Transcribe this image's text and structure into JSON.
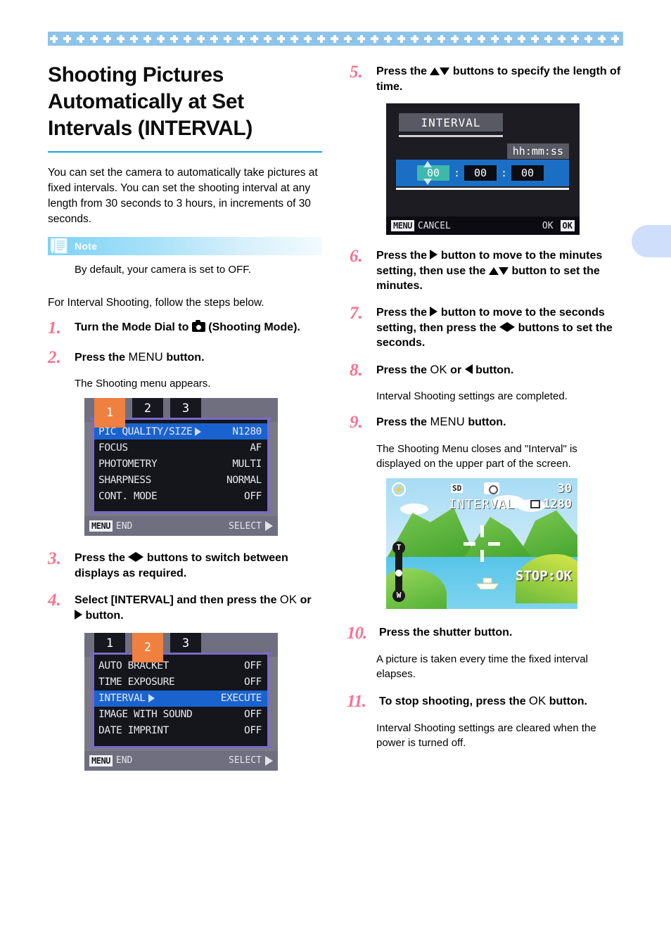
{
  "page": {
    "title": "Shooting Pictures Automatically at Set Intervals (INTERVAL)",
    "intro": "You can set the camera to automatically take pictures at fixed intervals. You can set the shooting interval at any length from 30 seconds to 3 hours, in increments of 30 seconds.",
    "lead": "For Interval Shooting, follow the steps below.",
    "accent_color": "#19a3dd",
    "step_number_color": "#f8728f",
    "band_color": "#8fc4ea"
  },
  "note": {
    "label": "Note",
    "icon": "note-pen-document-icon",
    "text": "By default, your camera is set to OFF."
  },
  "steps": [
    {
      "num": "1.",
      "text_before": "Turn the Mode Dial to ",
      "icon": "camera-mode-icon",
      "text_after": " (Shooting Mode)."
    },
    {
      "num": "2.",
      "text_before": "Press the ",
      "button": "MENU",
      "text_after": " button.",
      "sub": "The Shooting menu appears."
    },
    {
      "num": "3.",
      "text_before": "Press the ",
      "icon": "left-right-arrows-icon",
      "text_after": " buttons to switch between displays as required."
    },
    {
      "num": "4.",
      "text_before": "Select  [INTERVAL] and then press the ",
      "button": "OK",
      "mid": " or ",
      "icon": "right-arrow-icon",
      "text_after": " button."
    },
    {
      "num": "5.",
      "text_before": "Press the ",
      "icon": "up-down-arrows-icon",
      "text_after": " buttons to specify the length of time."
    },
    {
      "num": "6.",
      "text_before": "Press the ",
      "icon": "right-arrow-icon",
      "text_mid": " button to move to the minutes setting, then use the ",
      "icon2": "up-down-arrows-icon",
      "text_after": " button to set the minutes."
    },
    {
      "num": "7.",
      "text_before": "Press the ",
      "icon": "right-arrow-icon",
      "text_mid": " button to move to the seconds setting, then press the ",
      "icon2": "left-right-arrows-icon",
      "text_after": " buttons to set the seconds."
    },
    {
      "num": "8.",
      "text_before": "Press the ",
      "button": "OK",
      "mid": " or ",
      "icon": "left-arrow-icon",
      "text_after": " button.",
      "sub": "Interval Shooting settings are completed."
    },
    {
      "num": "9.",
      "text_before": "Press the ",
      "button": "MENU",
      "text_after": " button.",
      "sub": "The Shooting Menu closes and \"Interval\" is displayed on the upper part of the screen."
    },
    {
      "num": "10.",
      "text_before": "Press the shutter button.",
      "sub": "A picture is taken every time the fixed interval elapses."
    },
    {
      "num": "11.",
      "text_before": "To stop shooting, press the ",
      "button": "OK",
      "text_after": " button.",
      "sub": "Interval Shooting settings are cleared when the power is turned off."
    }
  ],
  "screens": {
    "shooting_menu_1": {
      "tabs": [
        "1",
        "2",
        "3"
      ],
      "active_tab": 0,
      "rows": [
        {
          "label": "PIC QUALITY/SIZE",
          "value": "N1280",
          "selected": true,
          "arrow": true
        },
        {
          "label": "FOCUS",
          "value": "AF",
          "selected": false,
          "arrow": false
        },
        {
          "label": "PHOTOMETRY",
          "value": "MULTI",
          "selected": false,
          "arrow": false
        },
        {
          "label": "SHARPNESS",
          "value": "NORMAL",
          "selected": false,
          "arrow": false
        },
        {
          "label": "CONT. MODE",
          "value": "OFF",
          "selected": false,
          "arrow": false
        }
      ],
      "bottom_left_key": "MENU",
      "bottom_left_text": "END",
      "bottom_right_text": "SELECT"
    },
    "shooting_menu_2": {
      "tabs": [
        "1",
        "2",
        "3"
      ],
      "active_tab": 1,
      "rows": [
        {
          "label": "AUTO BRACKET",
          "value": "OFF",
          "selected": false,
          "arrow": false
        },
        {
          "label": "TIME EXPOSURE",
          "value": "OFF",
          "selected": false,
          "arrow": false
        },
        {
          "label": "INTERVAL",
          "value": "EXECUTE",
          "selected": true,
          "arrow": true
        },
        {
          "label": "IMAGE WITH SOUND",
          "value": "OFF",
          "selected": false,
          "arrow": false
        },
        {
          "label": "DATE IMPRINT",
          "value": "OFF",
          "selected": false,
          "arrow": false
        }
      ],
      "bottom_left_key": "MENU",
      "bottom_left_text": "END",
      "bottom_right_text": "SELECT"
    },
    "interval_setting": {
      "title": "INTERVAL",
      "format_label": "hh:mm:ss",
      "hours": "00",
      "minutes": "00",
      "seconds": "00",
      "active_field": "hours",
      "bottom_left_key": "MENU",
      "bottom_left_text": "CANCEL",
      "bottom_right_text": "OK",
      "bottom_right_key": "OK"
    },
    "live_view": {
      "flash_icon": "flash-off-icon",
      "sd_label": "SD",
      "camera_icon": "camera-icon",
      "shots_remaining": "30",
      "image_size": "1280",
      "mode_text": "INTERVAL",
      "stop_text": "STOP:OK",
      "zoom_top": "T",
      "zoom_bottom": "W"
    }
  }
}
